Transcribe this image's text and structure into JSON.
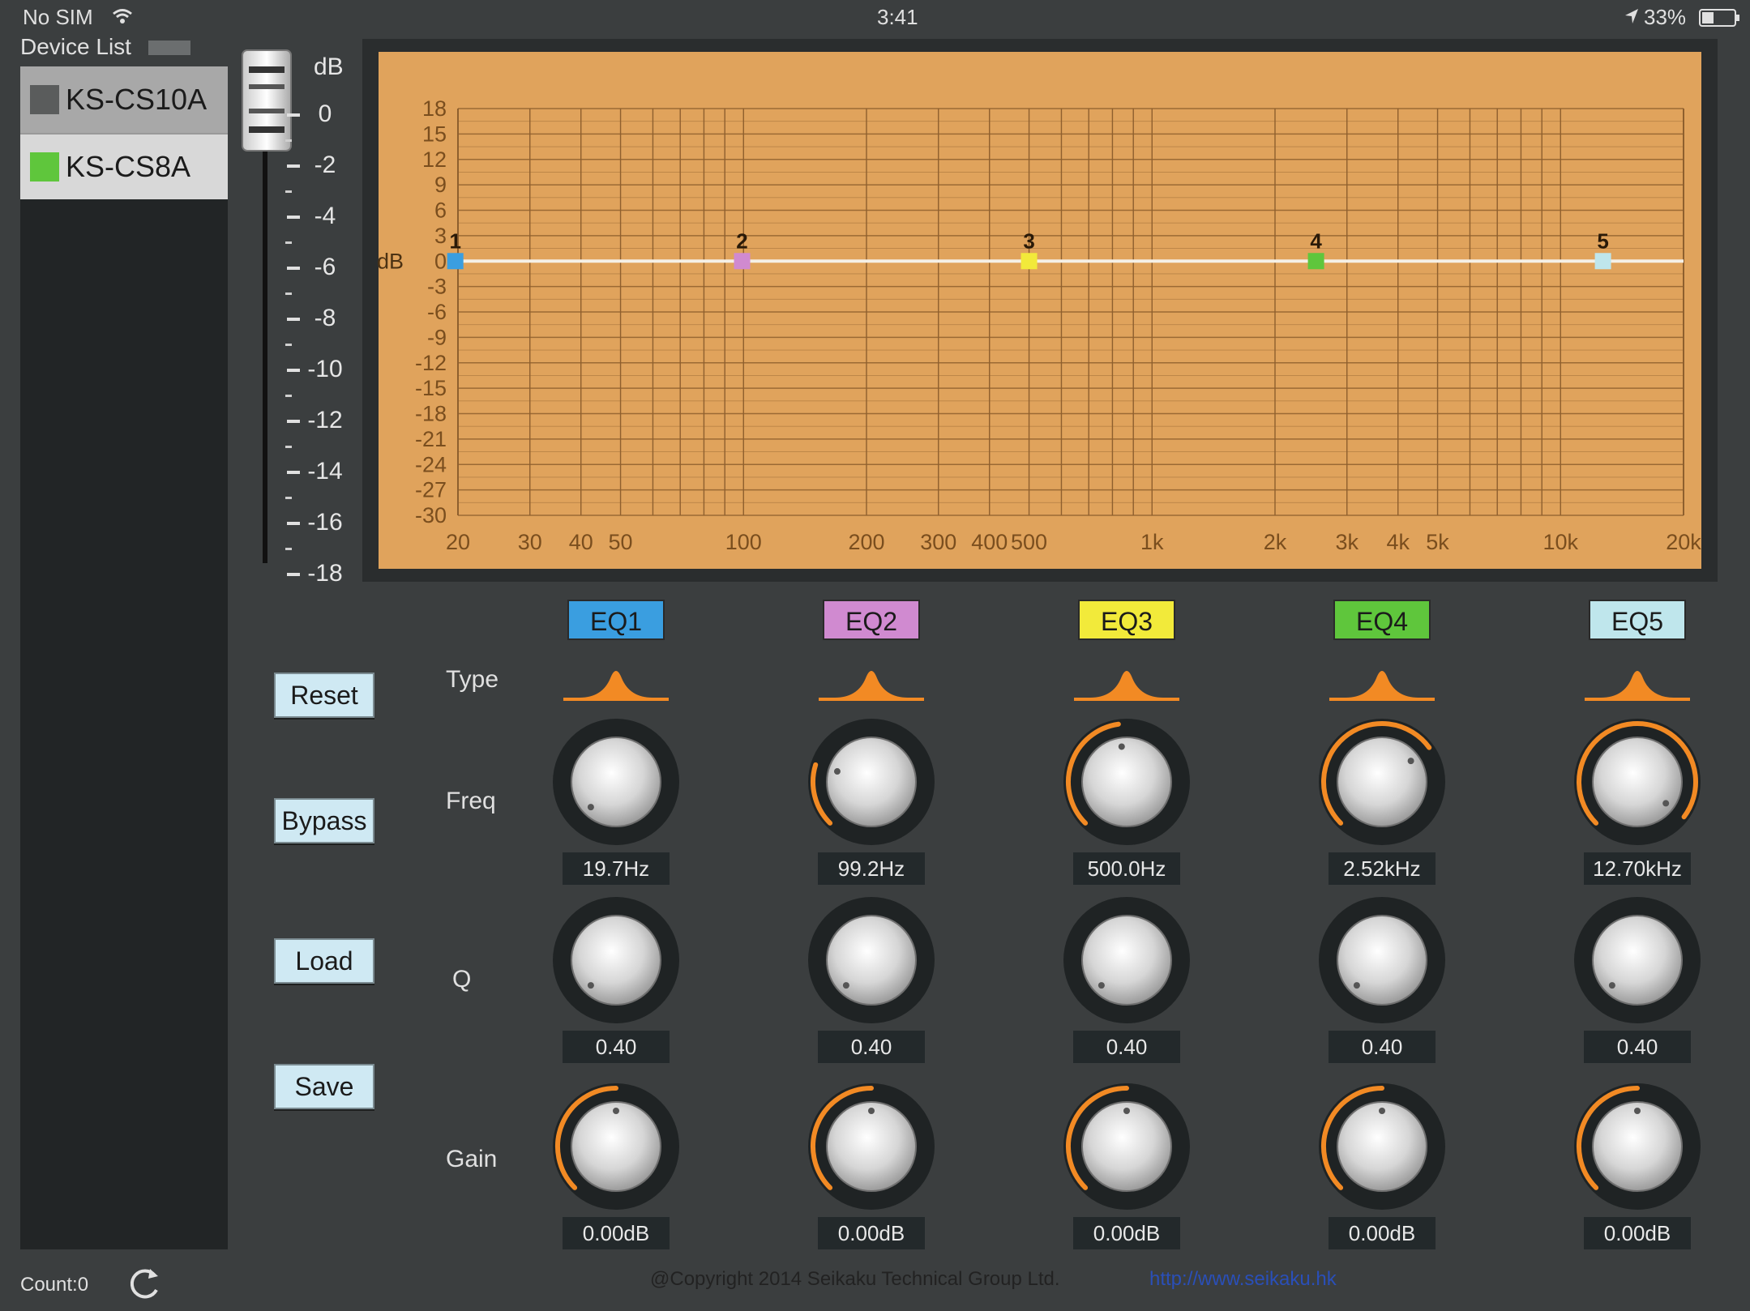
{
  "status_bar": {
    "carrier": "No SIM",
    "time": "3:41",
    "battery": "33%"
  },
  "device_list": {
    "title": "Device List",
    "items": [
      {
        "label": "KS-CS10A",
        "color": "#5a5c5c",
        "selected": true
      },
      {
        "label": "KS-CS8A",
        "color": "#5fc63c",
        "selected": false
      }
    ],
    "count_label": "Count:0"
  },
  "fader": {
    "unit": "dB",
    "ticks": [
      "0",
      "-2",
      "-4",
      "-6",
      "-8",
      "-10",
      "-12",
      "-14",
      "-16",
      "-18"
    ]
  },
  "chart_data": {
    "type": "line",
    "title": "",
    "xlabel": "",
    "ylabel": "dB",
    "xscale": "log",
    "xlim": [
      20,
      20000
    ],
    "ylim": [
      -30,
      18
    ],
    "y_ticks": [
      "18",
      "15",
      "12",
      "9",
      "6",
      "3",
      "0",
      "-3",
      "-6",
      "-9",
      "-12",
      "-15",
      "-18",
      "-21",
      "-24",
      "-27",
      "-30"
    ],
    "x_ticks": [
      "20",
      "30",
      "40",
      "50",
      "100",
      "200",
      "300",
      "400",
      "500",
      "1k",
      "2k",
      "3k",
      "4k",
      "5k",
      "10k",
      "20k"
    ],
    "curve": {
      "color": "#f5f0e6",
      "x": [
        20,
        20000
      ],
      "y": [
        0,
        0
      ]
    },
    "points": [
      {
        "label": "1",
        "freq": 19.7,
        "gain": 0,
        "color": "#3a9ee0"
      },
      {
        "label": "2",
        "freq": 99.2,
        "gain": 0,
        "color": "#d08ad0"
      },
      {
        "label": "3",
        "freq": 500,
        "gain": 0,
        "color": "#f2ea3a"
      },
      {
        "label": "4",
        "freq": 2520,
        "gain": 0,
        "color": "#5fc63c"
      },
      {
        "label": "5",
        "freq": 12700,
        "gain": 0,
        "color": "#bfe6ec"
      }
    ],
    "grid": true,
    "background": "#e0a35c"
  },
  "buttons": {
    "reset": "Reset",
    "bypass": "Bypass",
    "load": "Load",
    "save": "Save"
  },
  "row_labels": {
    "type": "Type",
    "freq": "Freq",
    "q": "Q",
    "gain": "Gain"
  },
  "accent_color": "#f28a24",
  "bands": [
    {
      "name": "EQ1",
      "color": "#3a9ee0",
      "type_icon": "peak-filter-icon",
      "freq": "19.7Hz",
      "freq_level": 0.0,
      "q": "0.40",
      "q_level": 0.0,
      "gain": "0.00dB",
      "gain_level": 0.5
    },
    {
      "name": "EQ2",
      "color": "#d08ad0",
      "type_icon": "peak-filter-icon",
      "freq": "99.2Hz",
      "freq_level": 0.23,
      "q": "0.40",
      "q_level": 0.0,
      "gain": "0.00dB",
      "gain_level": 0.5
    },
    {
      "name": "EQ3",
      "color": "#f2ea3a",
      "type_icon": "peak-filter-icon",
      "freq": "500.0Hz",
      "freq_level": 0.47,
      "q": "0.40",
      "q_level": 0.0,
      "gain": "0.00dB",
      "gain_level": 0.5
    },
    {
      "name": "EQ4",
      "color": "#5fc63c",
      "type_icon": "peak-filter-icon",
      "freq": "2.52kHz",
      "freq_level": 0.7,
      "q": "0.40",
      "q_level": 0.0,
      "gain": "0.00dB",
      "gain_level": 0.5
    },
    {
      "name": "EQ5",
      "color": "#bfe6ec",
      "type_icon": "peak-filter-icon",
      "freq": "12.70kHz",
      "freq_level": 0.97,
      "q": "0.40",
      "q_level": 0.0,
      "gain": "0.00dB",
      "gain_level": 0.5
    }
  ],
  "footer": {
    "copyright": "@Copyright 2014 Seikaku Technical Group Ltd.",
    "link": "http://www.seikaku.hk"
  }
}
